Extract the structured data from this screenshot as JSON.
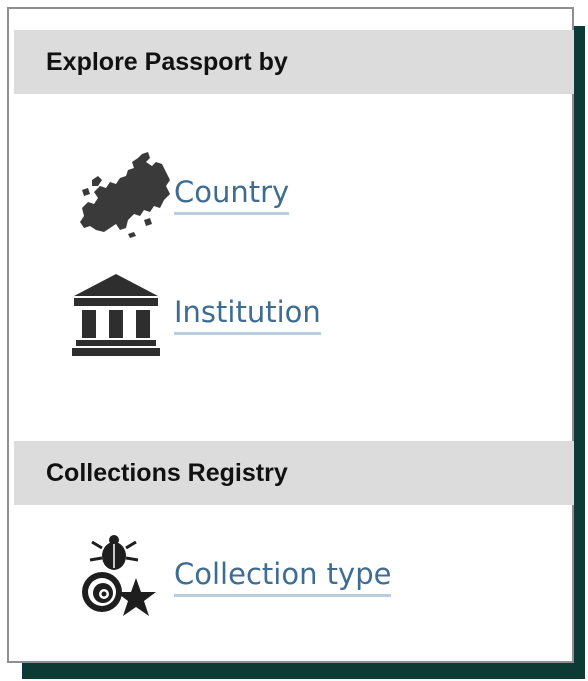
{
  "sections": [
    {
      "title": "Explore Passport by",
      "items": [
        {
          "label": "Country",
          "icon": "europe-map-icon"
        },
        {
          "label": "Institution",
          "icon": "institution-building-icon"
        }
      ]
    },
    {
      "title": "Collections Registry",
      "items": [
        {
          "label": "Collection type",
          "icon": "collection-type-icon"
        }
      ]
    }
  ],
  "colors": {
    "link": "#3f6c92",
    "link_underline": "#b9cde0",
    "header_bg": "#dcdcdc",
    "shadow": "#0d3a34"
  }
}
